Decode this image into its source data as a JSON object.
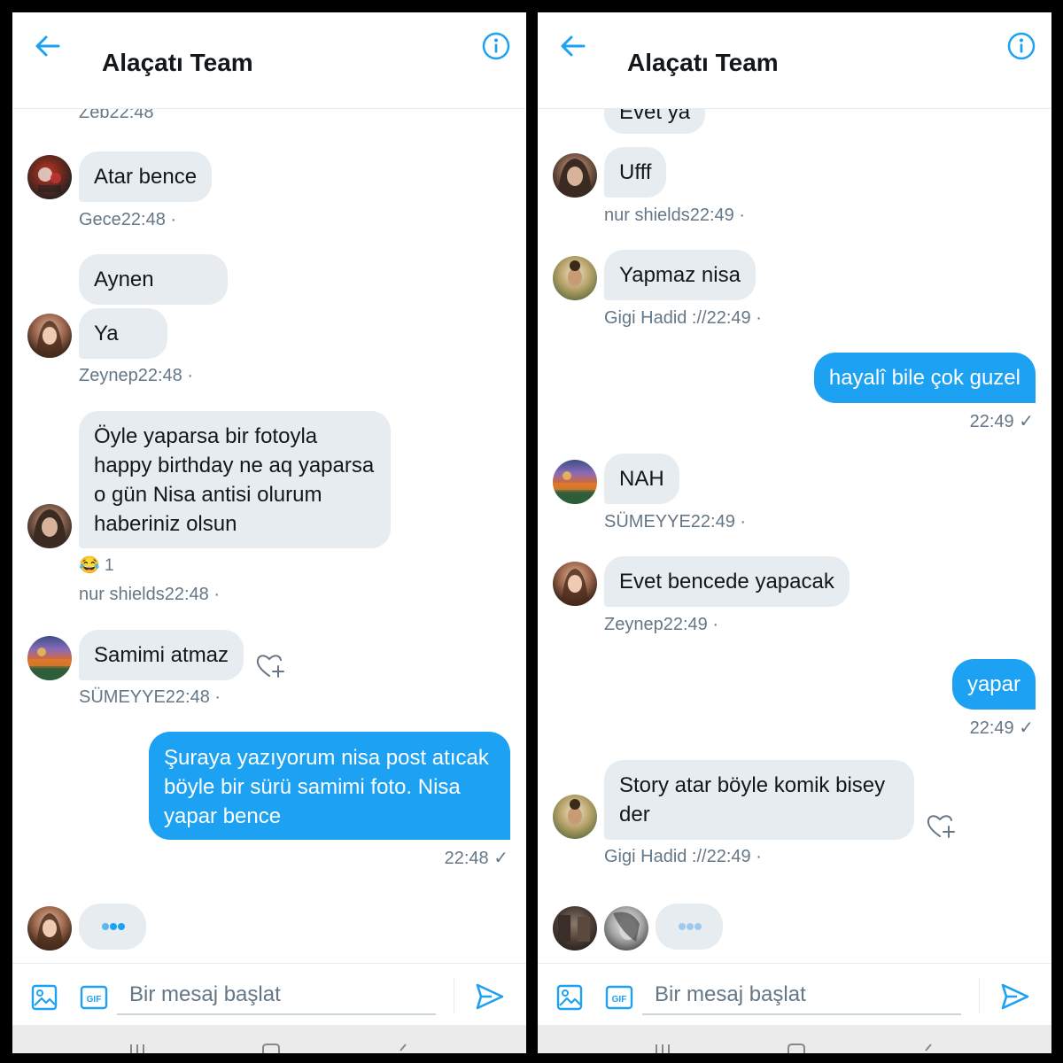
{
  "theme": {
    "accent": "#1da1f2",
    "bubble_in": "#e6ecf0",
    "meta_text": "#657786"
  },
  "panels": [
    {
      "header": {
        "title": "Alaçatı Team",
        "back_icon": "arrow-left-icon",
        "info_icon": "info-icon"
      },
      "top_cutoff": "Zeb22:48",
      "messages": [
        {
          "sender": "Gece",
          "text": "Atar bence",
          "meta": "Gece22:48 ·"
        },
        {
          "sender": "Zeynep",
          "text": "Aynen"
        },
        {
          "sender": "Zeynep",
          "text": "Ya",
          "meta": "Zeynep22:48 ·"
        },
        {
          "sender": "nur shields",
          "lines": [
            "Öyle yaparsa bir fotoyla",
            "happy birthday ne aq yaparsa",
            "o gün Nisa antisi olurum",
            "haberiniz olsun"
          ],
          "reaction": {
            "emoji": "😂",
            "count": "1"
          },
          "meta": "nur shields22:48 ·"
        },
        {
          "sender": "SÜMEYYE",
          "text": "Samimi atmaz",
          "meta": "SÜMEYYE22:48 ·"
        },
        {
          "sender": "me",
          "lines": [
            "Şuraya yazıyorum nisa post atıcak",
            "böyle bir sürü samimi foto. Nisa",
            "yapar bence"
          ],
          "meta": "22:48 ✓"
        }
      ],
      "composer": {
        "placeholder": "Bir mesaj başlat"
      }
    },
    {
      "header": {
        "title": "Alaçatı Team",
        "back_icon": "arrow-left-icon",
        "info_icon": "info-icon"
      },
      "top_cutoff": "Evet ya",
      "messages": [
        {
          "sender": "nur shields",
          "text": "Ufff",
          "meta": "nur shields22:49 ·"
        },
        {
          "sender": "Gigi Hadid ://",
          "text": "Yapmaz nisa",
          "meta": "Gigi Hadid ://22:49 ·"
        },
        {
          "sender": "me",
          "text": "hayalî bile çok guzel",
          "meta": "22:49 ✓"
        },
        {
          "sender": "SÜMEYYE",
          "text": "NAH",
          "meta": "SÜMEYYE22:49 ·"
        },
        {
          "sender": "Zeynep",
          "text": "Evet bencede yapacak",
          "meta": "Zeynep22:49 ·"
        },
        {
          "sender": "me",
          "text": "yapar",
          "meta": "22:49 ✓"
        },
        {
          "sender": "Gigi Hadid ://",
          "lines": [
            "Story atar böyle komik bisey",
            "der"
          ],
          "meta": "Gigi Hadid ://22:49 ·"
        }
      ],
      "composer": {
        "placeholder": "Bir mesaj başlat"
      }
    }
  ]
}
